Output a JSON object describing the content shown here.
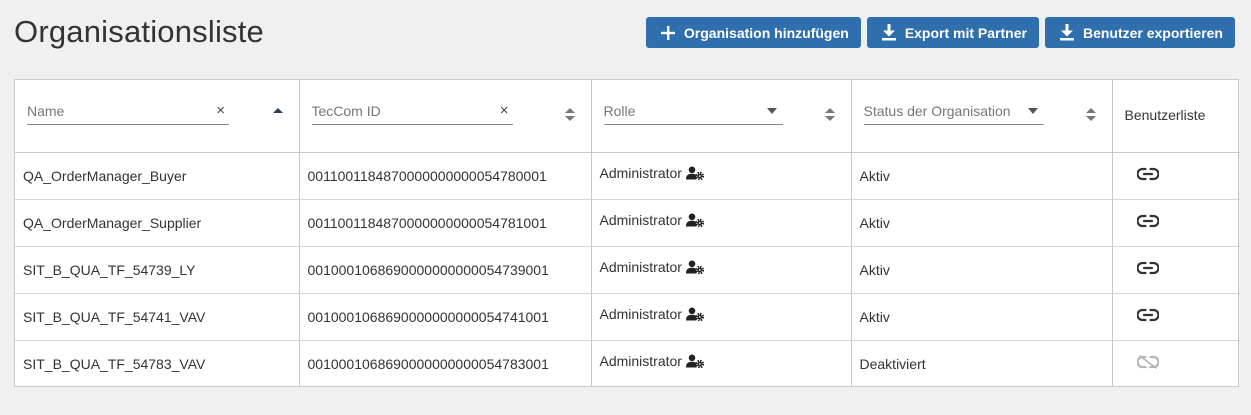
{
  "page": {
    "title": "Organisationsliste"
  },
  "toolbar": {
    "add_org": "Organisation hinzufügen",
    "export_partner": "Export mit Partner",
    "export_users": "Benutzer exportieren"
  },
  "table": {
    "filters": {
      "name_placeholder": "Name",
      "teccom_placeholder": "TecCom ID",
      "role_placeholder": "Rolle",
      "status_placeholder": "Status der Organisation",
      "userlist_label": "Benutzerliste"
    },
    "clear_symbol": "×",
    "rows": [
      {
        "name": "QA_OrderManager_Buyer",
        "teccom_id": "0011001184870000000000054780001",
        "role": "Administrator",
        "status": "Aktiv",
        "link": "active"
      },
      {
        "name": "QA_OrderManager_Supplier",
        "teccom_id": "0011001184870000000000054781001",
        "role": "Administrator",
        "status": "Aktiv",
        "link": "active"
      },
      {
        "name": "SIT_B_QUA_TF_54739_LY",
        "teccom_id": "0010001068690000000000054739001",
        "role": "Administrator",
        "status": "Aktiv",
        "link": "active"
      },
      {
        "name": "SIT_B_QUA_TF_54741_VAV",
        "teccom_id": "0010001068690000000000054741001",
        "role": "Administrator",
        "status": "Aktiv",
        "link": "active"
      },
      {
        "name": "SIT_B_QUA_TF_54783_VAV",
        "teccom_id": "0010001068690000000000054783001",
        "role": "Administrator",
        "status": "Deaktiviert",
        "link": "broken"
      }
    ]
  },
  "icons": {
    "add": "plus-icon",
    "download": "download-icon",
    "role": "user-gear-icon",
    "link": "link-icon",
    "unlink": "unlink-icon"
  },
  "colors": {
    "primary": "#2f6fad",
    "background": "#f0f0f0",
    "border": "#c9c9c9",
    "link_icon": "#333333",
    "unlink_icon": "#b5b5b5"
  }
}
